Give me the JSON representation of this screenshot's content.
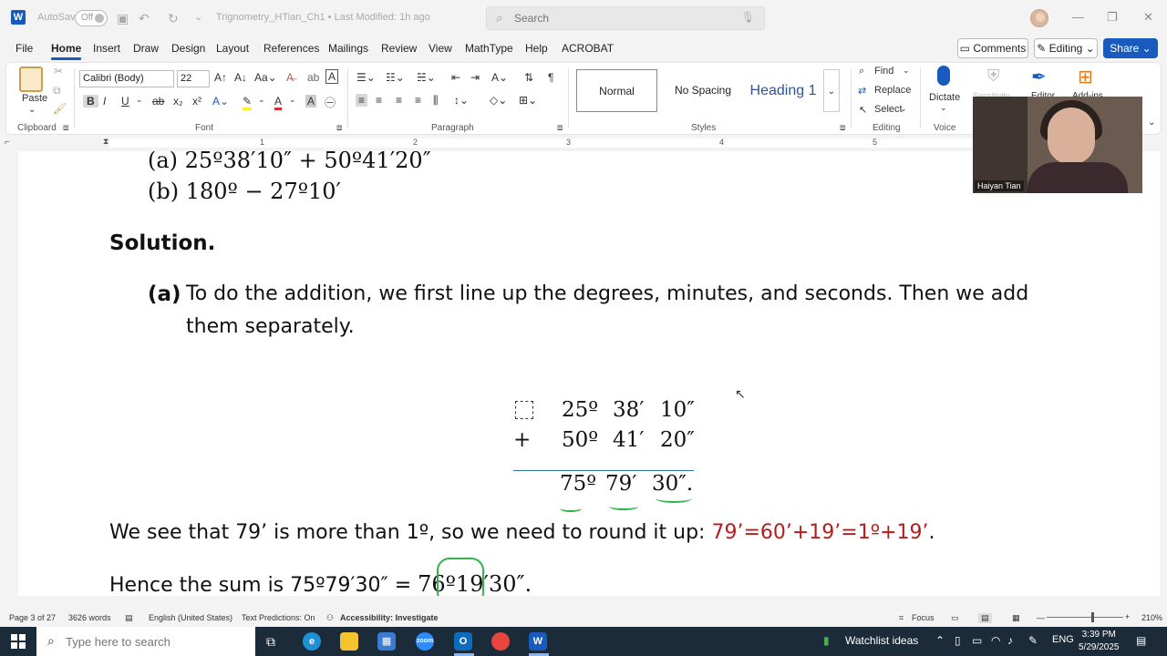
{
  "titlebar": {
    "autosave_label": "AutoSave",
    "autosave_state": "Off",
    "document_title": "Trignometry_HTian_Ch1  •  Last Modified: 1h ago",
    "search_placeholder": "Search"
  },
  "menu": {
    "tabs": [
      "File",
      "Home",
      "Insert",
      "Draw",
      "Design",
      "Layout",
      "References",
      "Mailings",
      "Review",
      "View",
      "MathType",
      "Help",
      "ACROBAT"
    ],
    "active_tab": "Home",
    "comments_label": "Comments",
    "editing_label": "Editing",
    "share_label": "Share"
  },
  "ribbon": {
    "clipboard": {
      "paste_label": "Paste",
      "group_label": "Clipboard"
    },
    "font": {
      "name": "Calibri (Body)",
      "size": "22",
      "group_label": "Font"
    },
    "paragraph": {
      "group_label": "Paragraph"
    },
    "styles": {
      "items": [
        "Normal",
        "No Spacing",
        "Heading 1"
      ],
      "group_label": "Styles"
    },
    "editing": {
      "find_label": "Find",
      "replace_label": "Replace",
      "select_label": "Select",
      "group_label": "Editing"
    },
    "voice": {
      "dictate_label": "Dictate",
      "group_label": "Voice"
    },
    "faded": {
      "sensitivity_label": "Sensitivity",
      "editor_label": "Editor",
      "addins_label": "Add-ins"
    }
  },
  "ruler": {
    "numbers": [
      "1",
      "2",
      "3",
      "4",
      "5"
    ]
  },
  "document": {
    "line_a": "(a)  25º38′10″ + 50º41′20″",
    "line_b": "(b)  180º − 27º10′",
    "solution_heading": "Solution.",
    "part_a_label": "(a)",
    "part_a_text_line1": "To do the addition, we first line up the degrees, minutes, and seconds. Then we add",
    "part_a_text_line2": "them separately.",
    "addition": {
      "row1": [
        "25º",
        "38′",
        "10″"
      ],
      "plus_sign": "+",
      "row2": [
        "50º",
        "41′",
        "20″"
      ],
      "result": [
        "75º",
        "79′",
        "30″."
      ]
    },
    "round_text_start": "We see that 79’ is more than 1º, so we need to round it up: ",
    "round_text_red": "79’=60’+19’=1º+19’",
    "round_text_end": ".",
    "hence_text": "Hence the sum is 75º79′30″ = ",
    "hence_circled": "76º",
    "hence_end": "19′30″."
  },
  "video": {
    "participant_name": "Haiyan Tian"
  },
  "statusbar": {
    "page": "Page 3 of 27",
    "words": "3626 words",
    "language": "English (United States)",
    "predictions": "Text Predictions: On",
    "accessibility": "Accessibility: Investigate",
    "focus": "Focus",
    "zoom": "210%"
  },
  "taskbar": {
    "search_placeholder": "Type here to search",
    "weather_label": "Watchlist ideas",
    "language": "ENG",
    "time": "3:39 PM",
    "date": "5/29/2025"
  },
  "colors": {
    "accent": "#185abd",
    "red_text": "#b71c1c",
    "ink_green": "#34b34a"
  }
}
